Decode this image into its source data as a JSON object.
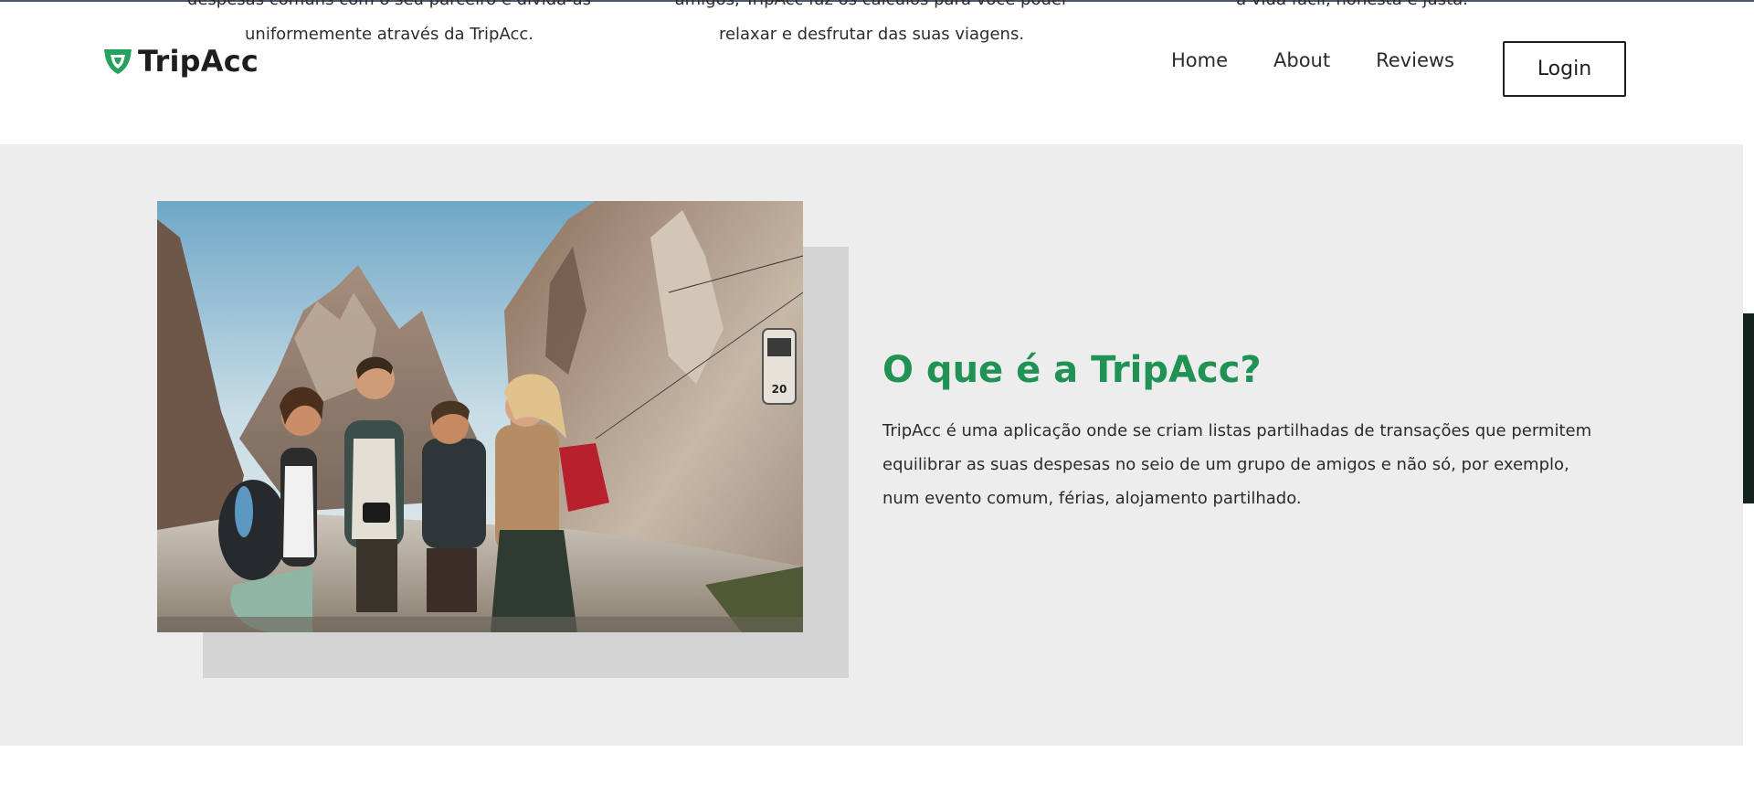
{
  "previous_section": {
    "columns": [
      {
        "line1": "despesas comuns com o seu parceiro e divida-as",
        "line2": "uniformemente através da TripAcc."
      },
      {
        "line1": "amigos, TripAcc faz os cálculos para você poder",
        "line2": "relaxar e desfrutar das suas viagens."
      },
      {
        "line1": "a vida fácil, honesta e justa.",
        "line2": ""
      }
    ]
  },
  "header": {
    "brand": "TripAcc",
    "logo_icon": "shield-icon",
    "nav": [
      {
        "label": "Home"
      },
      {
        "label": "About"
      },
      {
        "label": "Reviews"
      }
    ],
    "login_label": "Login"
  },
  "about": {
    "title": "O que é a TripAcc?",
    "description": "TripAcc é uma aplicação onde se criam listas partilhadas de transações que permitem equilibrar as suas despesas no seio de um grupo de amigos e não só, por exemplo, num evento comum, férias, alojamento partilhado.",
    "photo_text": "20"
  },
  "colors": {
    "accent": "#1f9254",
    "section_bg": "#ededed",
    "shadow_box": "#d4d4d4"
  }
}
